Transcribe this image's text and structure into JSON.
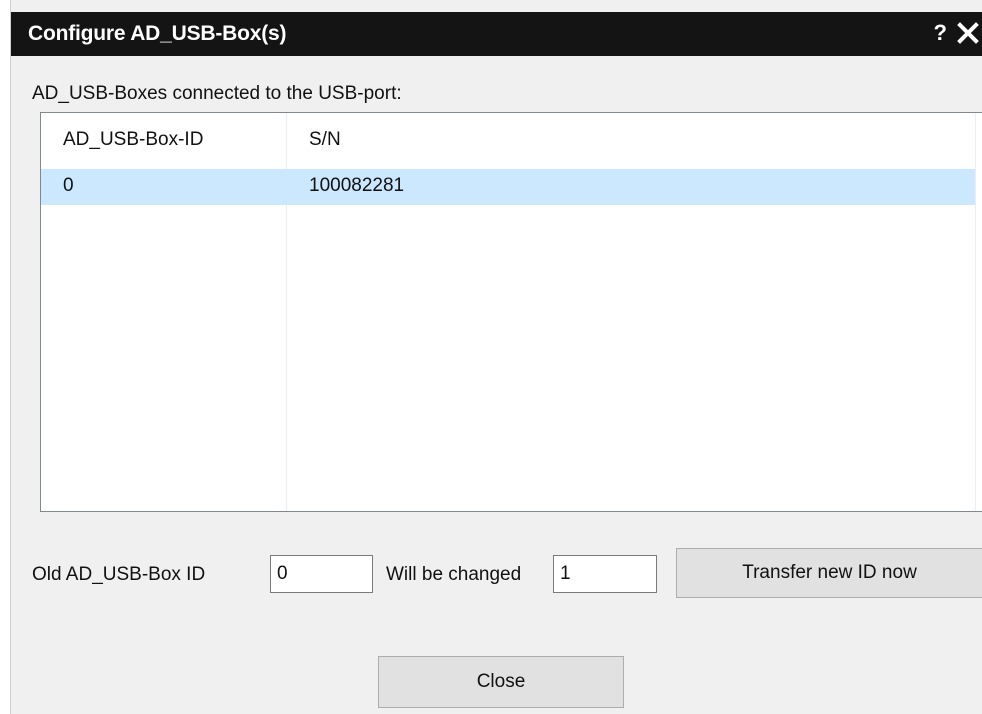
{
  "window": {
    "title": "Configure AD_USB-Box(s)",
    "help_label": "?",
    "close_icon": "close-icon",
    "title_bar_color": "#141414"
  },
  "list": {
    "label": "AD_USB-Boxes connected to the USB-port:",
    "columns": [
      "AD_USB-Box-ID",
      "S/N"
    ],
    "rows": [
      {
        "id": "0",
        "sn": "100082281",
        "selected": true
      }
    ],
    "selection_color": "#cce8ff"
  },
  "change_id": {
    "old_label": "Old AD_USB-Box ID",
    "old_value": "0",
    "new_label": "Will be changed",
    "new_value": "1",
    "transfer_label": "Transfer new ID now"
  },
  "footer": {
    "close_label": "Close"
  }
}
